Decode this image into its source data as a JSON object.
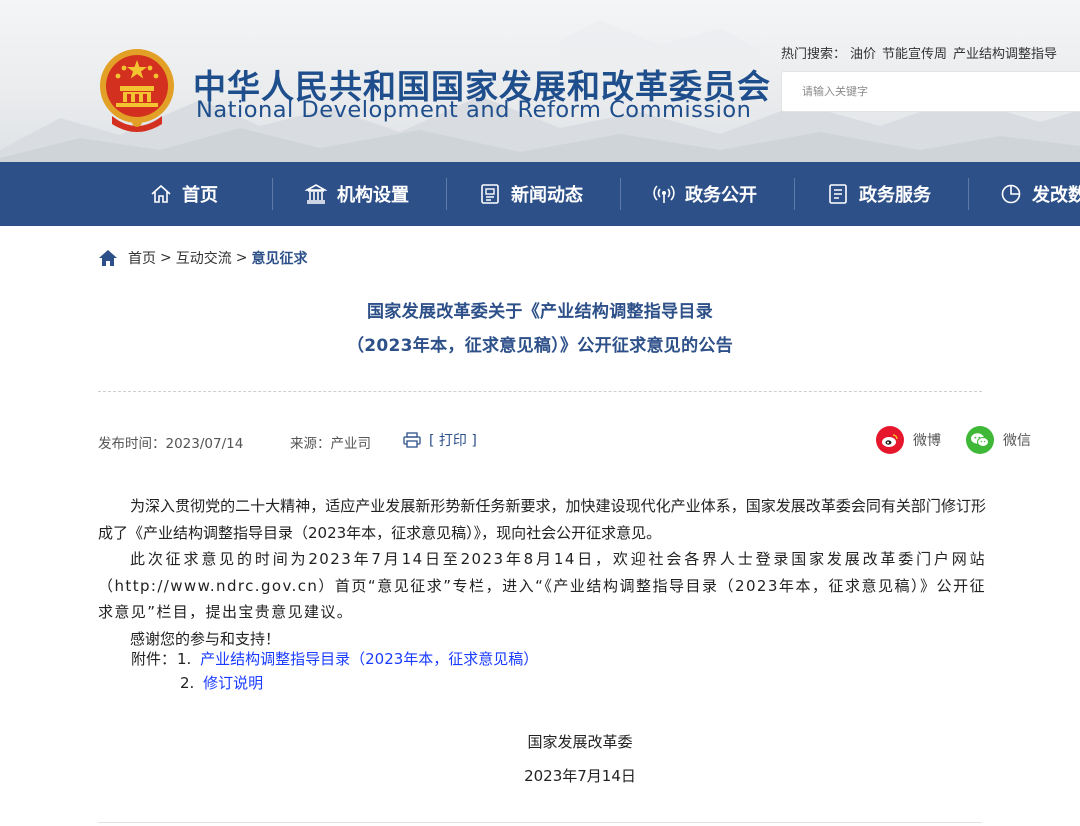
{
  "header": {
    "title_cn": "中华人民共和国国家发展和改革委员会",
    "title_en": "National Development and Reform Commission",
    "hot_search_label": "热门搜索：",
    "hot_search_terms": [
      "油价",
      "节能宣传周",
      "产业结构调整指导"
    ],
    "search_placeholder": "请输入关键字"
  },
  "nav": {
    "items": [
      {
        "label": "首页",
        "icon": "home-outline-icon"
      },
      {
        "label": "机构设置",
        "icon": "institution-building-icon"
      },
      {
        "label": "新闻动态",
        "icon": "news-document-icon"
      },
      {
        "label": "政务公开",
        "icon": "broadcast-icon"
      },
      {
        "label": "政务服务",
        "icon": "service-form-icon"
      },
      {
        "label": "发改数",
        "icon": "pie-chart-icon"
      }
    ]
  },
  "breadcrumb": {
    "home": "首页",
    "section": "互动交流",
    "current": "意见征求",
    "separator": ">"
  },
  "article": {
    "title_line1": "国家发展改革委关于《产业结构调整指导目录",
    "title_line2": "（2023年本，征求意见稿）》公开征求意见的公告",
    "publish_label": "发布时间：",
    "publish_date": "2023/07/14",
    "source_label": "来源：",
    "source": "产业司",
    "print_label": "[ 打印 ]",
    "share_weibo": "微博",
    "share_wechat": "微信",
    "paragraph1": "为深入贯彻党的二十大精神，适应产业发展新形势新任务新要求，加快建设现代化产业体系，国家发展改革委会同有关部门修订形成了《产业结构调整指导目录（2023年本，征求意见稿）》，现向社会公开征求意见。",
    "paragraph2": "此次征求意见的时间为2023年7月14日至2023年8月14日，欢迎社会各界人士登录国家发展改革委门户网站（http://www.ndrc.gov.cn）首页“意见征求”专栏，进入“《产业结构调整指导目录（2023年本，征求意见稿）》公开征求意见”栏目，提出宝贵意见建议。",
    "paragraph3": "感谢您的参与和支持！",
    "attachment_label": "附件：",
    "attachments": [
      {
        "num": "1.",
        "text": "产业结构调整指导目录（2023年本，征求意见稿）"
      },
      {
        "num": "2.",
        "text": "修订说明"
      }
    ],
    "signature_org": "国家发展改革委",
    "signature_date": "2023年7月14日"
  },
  "colors": {
    "nav_bg": "#2d5089",
    "title_blue": "#2d5089",
    "link_blue": "#1a3cff",
    "weibo_red": "#e6162d",
    "wechat_green": "#3fb837"
  }
}
